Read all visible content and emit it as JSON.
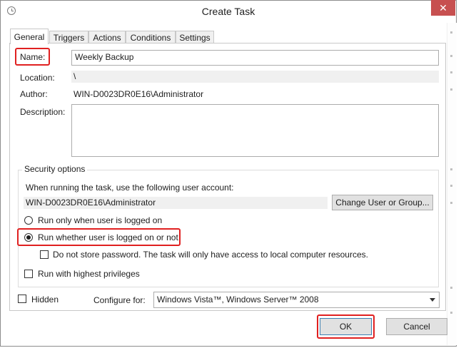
{
  "window": {
    "title": "Create Task",
    "close_label": "✕"
  },
  "tabs": [
    {
      "label": "General"
    },
    {
      "label": "Triggers"
    },
    {
      "label": "Actions"
    },
    {
      "label": "Conditions"
    },
    {
      "label": "Settings"
    }
  ],
  "general": {
    "name_label": "Name:",
    "name_value": "Weekly Backup",
    "location_label": "Location:",
    "location_value": "\\",
    "author_label": "Author:",
    "author_value": "WIN-D0023DR0E16\\Administrator",
    "description_label": "Description:",
    "description_value": ""
  },
  "security": {
    "group_title": "Security options",
    "account_prompt": "When running the task, use the following user account:",
    "account_value": "WIN-D0023DR0E16\\Administrator",
    "change_user_button": "Change User or Group...",
    "radio_logged_on": "Run only when user is logged on",
    "radio_whether": "Run whether user is logged on or not",
    "no_store_password": "Do not store password.  The task will only have access to local computer resources.",
    "highest_privileges": "Run with highest privileges"
  },
  "footer": {
    "hidden_label": "Hidden",
    "configure_label": "Configure for:",
    "configure_value": "Windows Vista™, Windows Server™ 2008",
    "ok_button": "OK",
    "cancel_button": "Cancel"
  },
  "colors": {
    "highlight": "#e02020",
    "close_button": "#c75050"
  }
}
